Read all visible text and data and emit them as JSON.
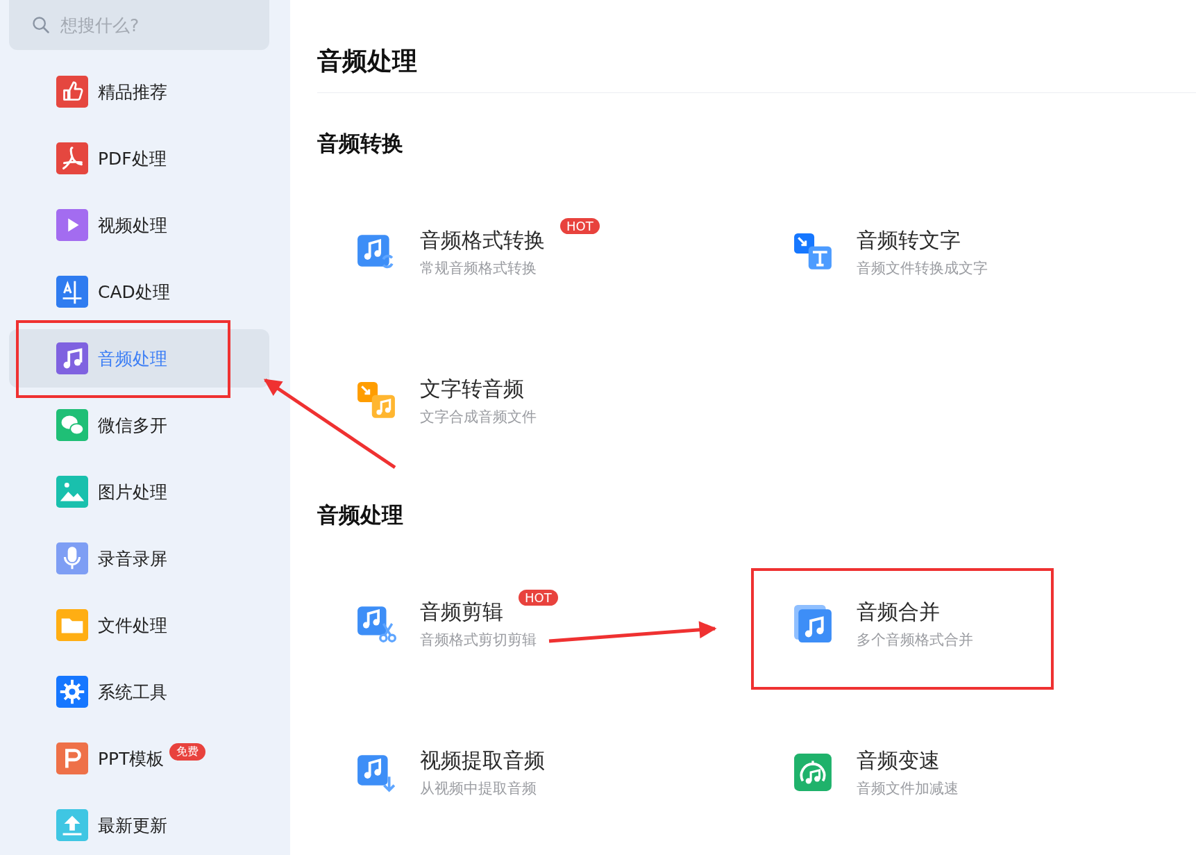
{
  "search": {
    "placeholder": "想搜什么?"
  },
  "sidebar": {
    "items": [
      {
        "label": "精品推荐",
        "selected": false
      },
      {
        "label": "PDF处理",
        "selected": false
      },
      {
        "label": "视频处理",
        "selected": false
      },
      {
        "label": "CAD处理",
        "selected": false
      },
      {
        "label": "音频处理",
        "selected": true
      },
      {
        "label": "微信多开",
        "selected": false
      },
      {
        "label": "图片处理",
        "selected": false
      },
      {
        "label": "录音录屏",
        "selected": false
      },
      {
        "label": "文件处理",
        "selected": false
      },
      {
        "label": "系统工具",
        "selected": false
      },
      {
        "label": "PPT模板",
        "selected": false,
        "badge": "免费"
      },
      {
        "label": "最新更新",
        "selected": false
      }
    ]
  },
  "page_title": "音频处理",
  "sections": [
    {
      "heading": "音频转换",
      "tools": [
        {
          "title": "音频格式转换",
          "description": "常规音频格式转换",
          "badge": "HOT"
        },
        {
          "title": "音频转文字",
          "description": "音频文件转换成文字"
        },
        {
          "title": "文字转音频",
          "description": "文字合成音频文件"
        }
      ]
    },
    {
      "heading": "音频处理",
      "tools": [
        {
          "title": "音频剪辑",
          "description": "音频格式剪切剪辑",
          "badge": "HOT"
        },
        {
          "title": "音频合并",
          "description": "多个音频格式合并"
        },
        {
          "title": "视频提取音频",
          "description": "从视频中提取音频"
        },
        {
          "title": "音频变速",
          "description": "音频文件加减速"
        }
      ]
    }
  ]
}
